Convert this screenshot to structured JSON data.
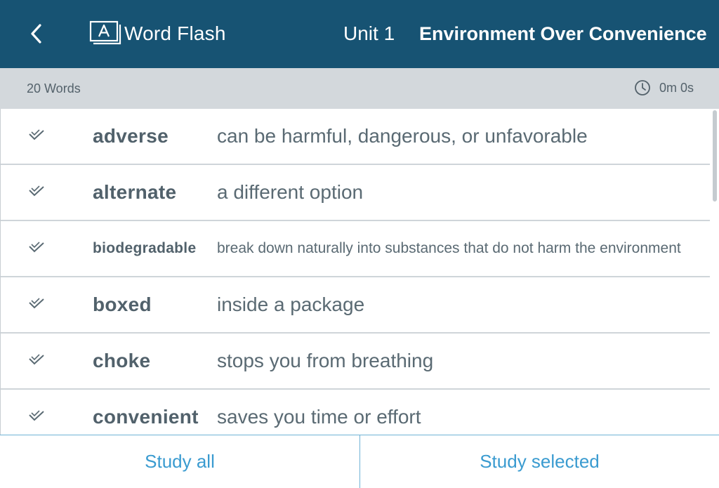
{
  "header": {
    "back_icon": "chevron-left-icon",
    "app_icon": "flashcard-a-icon",
    "app_name": "Word Flash",
    "unit": "Unit 1",
    "title": "Environment Over Convenience"
  },
  "info": {
    "word_count": "20 Words",
    "timer_icon": "clock-icon",
    "timer": "0m 0s"
  },
  "words": [
    {
      "term": "adverse",
      "definition": "can be harmful, dangerous, or unfavorable"
    },
    {
      "term": "alternate",
      "definition": "a different option"
    },
    {
      "term": "biodegradable",
      "definition": "break down naturally into substances that do not harm the environment"
    },
    {
      "term": "boxed",
      "definition": "inside a package"
    },
    {
      "term": "choke",
      "definition": "stops you from breathing"
    },
    {
      "term": "convenient",
      "definition": "saves you time or effort"
    }
  ],
  "footer": {
    "study_all": "Study all",
    "study_selected": "Study selected"
  },
  "colors": {
    "header_bg": "#175373",
    "info_bg": "#d3d8dc",
    "accent": "#3a9bd0"
  }
}
